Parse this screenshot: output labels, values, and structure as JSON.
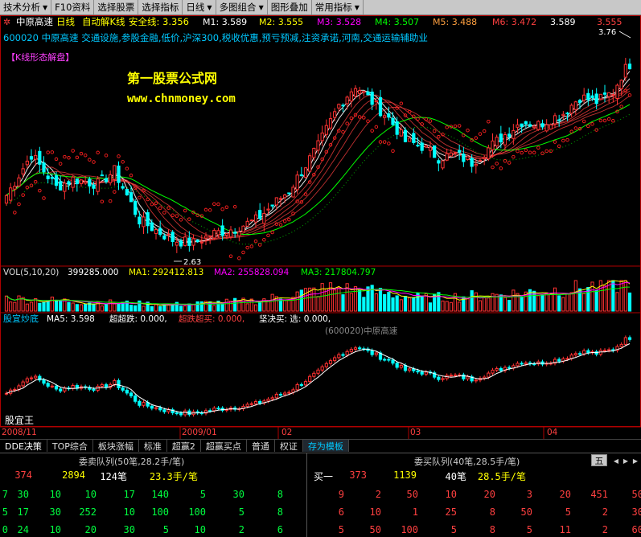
{
  "menu": {
    "items": [
      "技术分析",
      "F10资料",
      "选择股票",
      "选择指标",
      "日线",
      "多图组合",
      "图形叠加",
      "常用指标"
    ]
  },
  "colors": {
    "up": "#ff3232",
    "down": "#00ffff",
    "bg": "#000000",
    "ma1": "#ffffff",
    "ma2": "#ffff00",
    "ma3": "#ff00ff",
    "ma4": "#00ff00",
    "ma5": "#ff8000",
    "ma6": "#ff0000",
    "ribbon": "#ff4040",
    "sar": "#ff2020"
  },
  "header": {
    "stock": "中原高速",
    "period": "日线",
    "indicator": "自动解K线",
    "safe": "安全线: 3.356",
    "ma_values": [
      "M1: 3.589",
      "M2: 3.555",
      "M3: 3.528",
      "M4: 3.507",
      "M5: 3.488",
      "M6: 3.472",
      "3.589",
      "3.555"
    ]
  },
  "info": {
    "text": "600020 中原高速 交通设施,参股金融,低价,沪深300,税收优惠,预亏预减,注资承诺,河南,交通运输辅助业"
  },
  "labels": {
    "kline": "【K线形态解盘】",
    "brand": "第一股票公式网",
    "url": "www.chnmoney.com",
    "hi": "3.76",
    "lo": "2.63",
    "watermark": "(600020)中原高速",
    "bottom_name": "股宜王"
  },
  "vol": {
    "title": "VOL(5,10,20)",
    "vol": "399285.000",
    "ma1": "MA1: 292412.813",
    "ma2": "MA2: 255828.094",
    "ma3": "MA3: 217804.797"
  },
  "lower": {
    "name": "股宜炒底",
    "ma5": "MA5: 3.598",
    "chao": "超超跌: 0.000,",
    "chaod": "超跌超买: 0.000,",
    "jian": "坚决买: 选: 0.000,"
  },
  "xaxis": [
    "2008/11",
    "2009/01",
    "02",
    "03",
    "04"
  ],
  "tabs": [
    "DDE决策",
    "TOP综合",
    "板块涨幅",
    "标准",
    "超赢2",
    "超赢买点",
    "普通",
    "权证",
    "存为模板"
  ],
  "orderbook": {
    "sell_title": "委卖队列(50笔,28.2手/笔)",
    "buy_title": "委买队列(40笔,28.5手/笔)",
    "sell_head": [
      "374",
      "2894",
      "124笔",
      "23.3手/笔"
    ],
    "buy_head": [
      "买一",
      "373",
      "1139",
      "40笔",
      "28.5手/笔"
    ],
    "sell_rows": [
      [
        "7",
        "30",
        "10",
        "10",
        "17",
        "140",
        "5",
        "30",
        "8"
      ],
      [
        "5",
        "17",
        "30",
        "252",
        "10",
        "100",
        "100",
        "5",
        "8"
      ],
      [
        "0",
        "24",
        "10",
        "20",
        "30",
        "5",
        "10",
        "2",
        "6"
      ]
    ],
    "buy_rows": [
      [
        "9",
        "2",
        "50",
        "10",
        "20",
        "3",
        "20",
        "451",
        "50"
      ],
      [
        "6",
        "10",
        "1",
        "25",
        "8",
        "50",
        "5",
        "2",
        "30"
      ],
      [
        "5",
        "50",
        "100",
        "5",
        "8",
        "5",
        "11",
        "2",
        "60"
      ]
    ],
    "page_btn": "五"
  },
  "chart_data": {
    "type": "candlestick",
    "title": "中原高速 日线",
    "x_labels": [
      "2008/11",
      "2009/01",
      "02",
      "03",
      "04"
    ],
    "ylim": [
      2.55,
      3.85
    ],
    "high_label": "3.76",
    "low_label": "2.63",
    "anchors": [
      [
        0,
        2.95
      ],
      [
        6,
        3.2
      ],
      [
        12,
        3.0
      ],
      [
        16,
        3.05
      ],
      [
        22,
        3.02
      ],
      [
        26,
        3.1
      ],
      [
        32,
        2.8
      ],
      [
        40,
        2.68
      ],
      [
        45,
        2.66
      ],
      [
        50,
        2.72
      ],
      [
        55,
        2.75
      ],
      [
        60,
        2.8
      ],
      [
        68,
        2.98
      ],
      [
        75,
        3.25
      ],
      [
        80,
        3.5
      ],
      [
        84,
        3.62
      ],
      [
        88,
        3.52
      ],
      [
        92,
        3.42
      ],
      [
        96,
        3.28
      ],
      [
        100,
        3.25
      ],
      [
        104,
        3.18
      ],
      [
        108,
        3.2
      ],
      [
        112,
        3.15
      ],
      [
        118,
        3.28
      ],
      [
        124,
        3.4
      ],
      [
        128,
        3.38
      ],
      [
        134,
        3.45
      ],
      [
        138,
        3.55
      ],
      [
        142,
        3.52
      ],
      [
        146,
        3.58
      ],
      [
        148,
        3.68
      ],
      [
        150,
        3.76
      ]
    ],
    "vol_anchors": [
      [
        0,
        1.0
      ],
      [
        20,
        0.7
      ],
      [
        40,
        0.5
      ],
      [
        60,
        0.8
      ],
      [
        78,
        1.8
      ],
      [
        86,
        1.6
      ],
      [
        100,
        1.0
      ],
      [
        120,
        1.3
      ],
      [
        150,
        2.2
      ]
    ]
  }
}
